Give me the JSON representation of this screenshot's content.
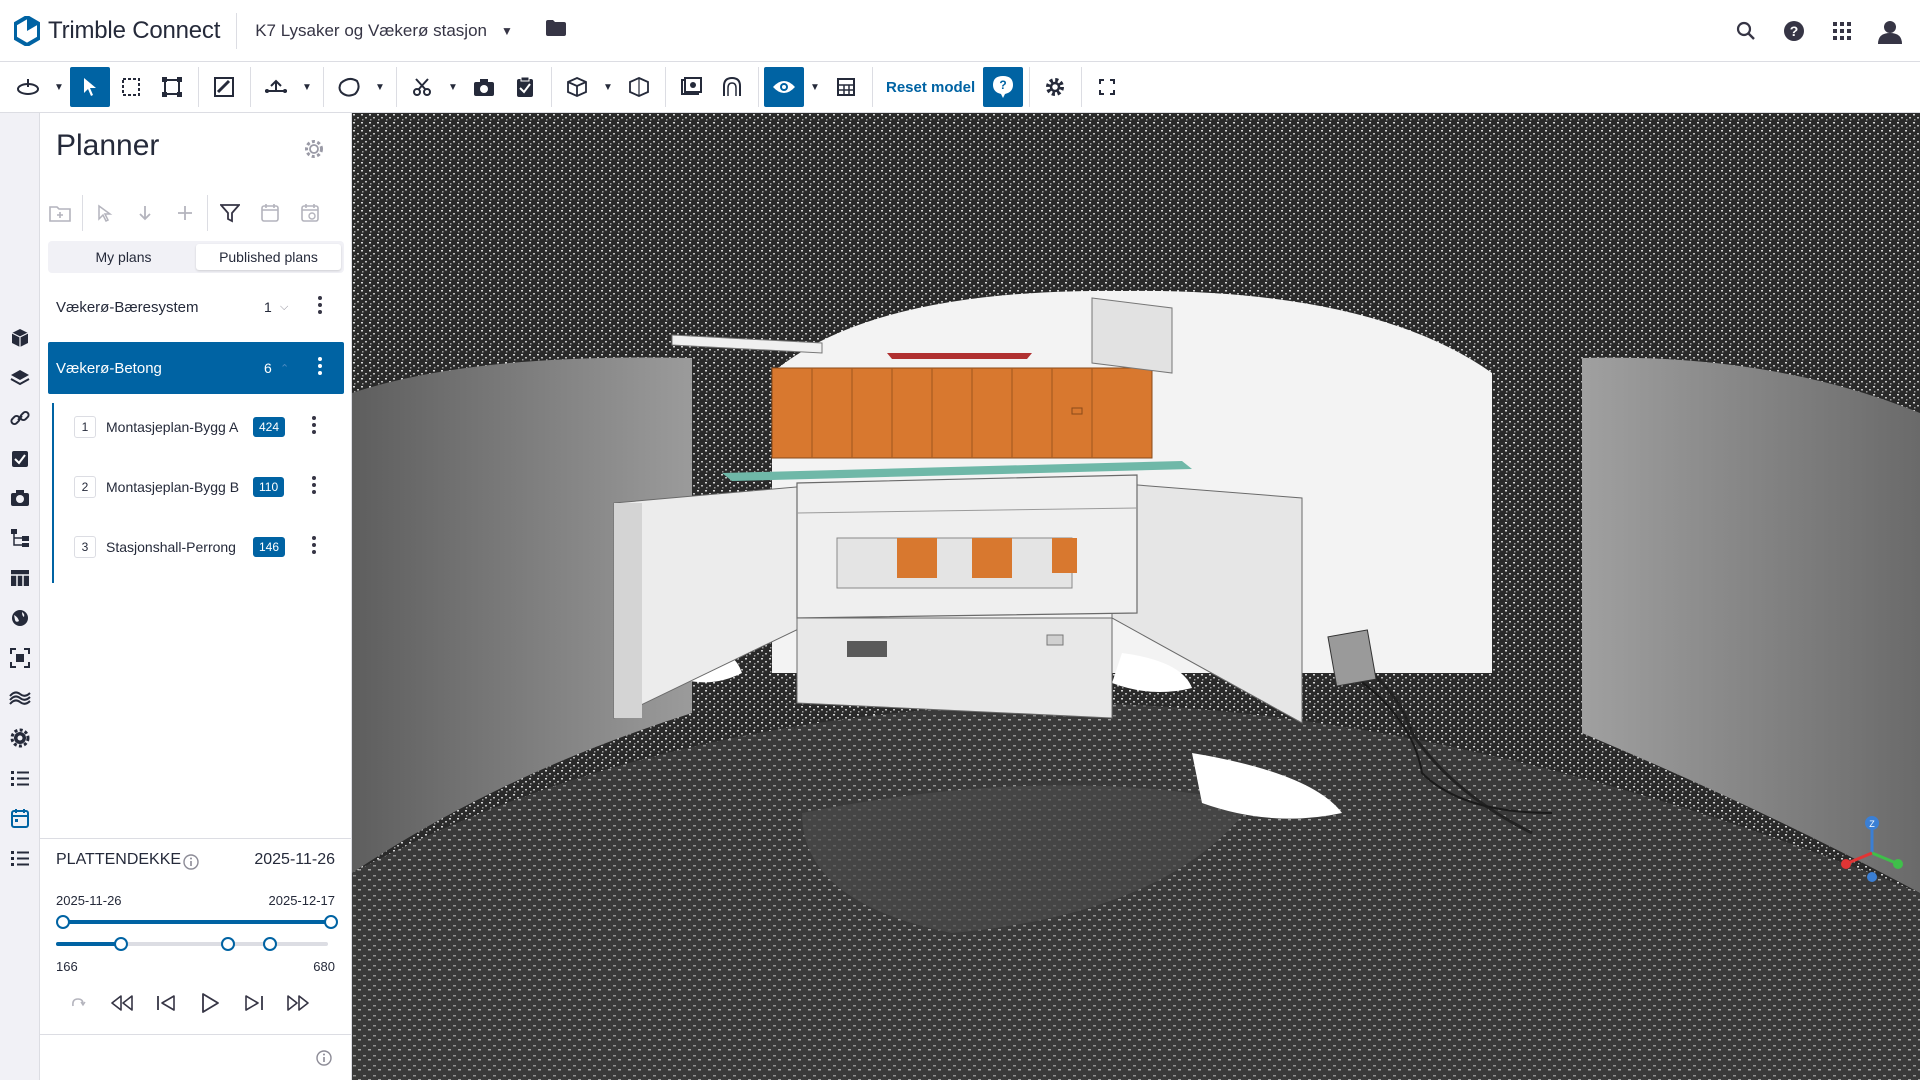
{
  "app": {
    "brand_bold": "Trimble",
    "brand_light": "Connect",
    "project_name": "K7 Lysaker og Vækerø stasjon"
  },
  "toolbar": {
    "reset_model_label": "Reset model"
  },
  "planner": {
    "title": "Planner",
    "tabs": [
      {
        "label": "My plans"
      },
      {
        "label": "Published plans",
        "selected": true
      }
    ],
    "plans": [
      {
        "name": "Vækerø-Bæresystem",
        "count": "1",
        "selected": false
      },
      {
        "name": "Vækerø-Betong",
        "count": "6",
        "selected": true
      }
    ],
    "sub_plans": [
      {
        "index": "1",
        "name": "Montasjeplan-Bygg A",
        "badge": "424"
      },
      {
        "index": "2",
        "name": "Montasjeplan-Bygg B",
        "badge": "110"
      },
      {
        "index": "3",
        "name": "Stasjonshall-Perrong",
        "badge": "146"
      }
    ],
    "playback": {
      "label": "PLATTENDEKKE",
      "current_date": "2025-11-26",
      "range_start": "2025-11-26",
      "range_end": "2025-12-17",
      "min_value": "166",
      "max_value": "680",
      "progress_fraction": 0.24
    }
  },
  "colors": {
    "accent": "#0063a3",
    "model_orange": "#d8782f",
    "background": "#ffffff"
  }
}
